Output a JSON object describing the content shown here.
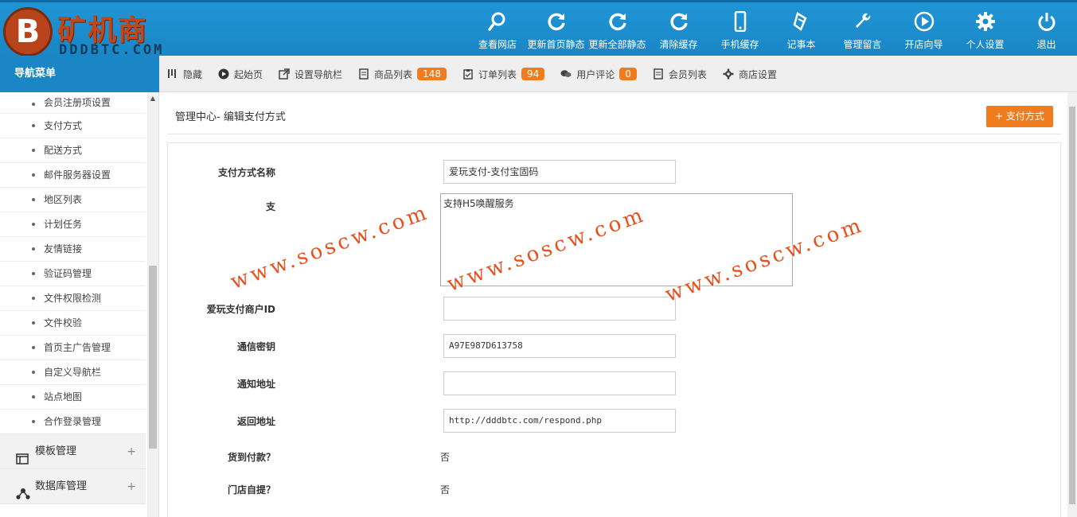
{
  "logo": {
    "badge": "B",
    "title": "矿机商城",
    "subtitle": "DDDBTC.COM"
  },
  "top_nav": [
    {
      "label": "查看网店",
      "icon": "search-icon"
    },
    {
      "label": "更新首页静态",
      "icon": "refresh-icon"
    },
    {
      "label": "更新全部静态",
      "icon": "refresh-icon"
    },
    {
      "label": "清除缓存",
      "icon": "refresh-icon"
    },
    {
      "label": "手机缓存",
      "icon": "mobile-icon"
    },
    {
      "label": "记事本",
      "icon": "notepad-icon"
    },
    {
      "label": "管理留言",
      "icon": "wrench-icon"
    },
    {
      "label": "开店向导",
      "icon": "play-icon"
    },
    {
      "label": "个人设置",
      "icon": "gear-icon"
    },
    {
      "label": "退出",
      "icon": "power-icon"
    }
  ],
  "sidebar": {
    "header": "导航菜单",
    "items": [
      "会员注册项设置",
      "支付方式",
      "配送方式",
      "邮件服务器设置",
      "地区列表",
      "计划任务",
      "友情链接",
      "验证码管理",
      "文件权限检测",
      "文件校验",
      "首页主广告管理",
      "自定义导航栏",
      "站点地图",
      "合作登录管理"
    ],
    "groups": [
      {
        "label": "模板管理",
        "icon": "template-icon",
        "toggle": "+"
      },
      {
        "label": "数据库管理",
        "icon": "database-icon",
        "toggle": "+"
      }
    ]
  },
  "quick_bar": [
    {
      "label": "隐藏",
      "icon": "bars-icon"
    },
    {
      "label": "起始页",
      "icon": "play-circle-icon"
    },
    {
      "label": "设置导航栏",
      "icon": "external-link-icon"
    },
    {
      "label": "商品列表",
      "icon": "list-icon",
      "badge": "148"
    },
    {
      "label": "订单列表",
      "icon": "clipboard-icon",
      "badge": "94"
    },
    {
      "label": "用户评论",
      "icon": "chat-icon",
      "badge": "0"
    },
    {
      "label": "会员列表",
      "icon": "member-icon"
    },
    {
      "label": "商店设置",
      "icon": "shop-icon"
    }
  ],
  "content": {
    "breadcrumb": "管理中心- 编辑支付方式",
    "add_button": "+ 支付方式",
    "form": {
      "name_label": "支付方式名称",
      "name_value": "爱玩支付-支付宝固码",
      "desc_label": "支",
      "desc_value": "支持H5唤醒服务",
      "merchant_label": "爱玩支付商户ID",
      "merchant_value": "",
      "key_label": "通信密钥",
      "key_value": "A97E987D613758",
      "notify_label": "通知地址",
      "notify_value": "",
      "return_label": "返回地址",
      "return_value": "http://dddbtc.com/respond.php",
      "cod_label": "货到付款？",
      "cod_value": "否",
      "pickup_label": "门店自提？",
      "pickup_value": "否"
    }
  },
  "watermark": "www.soscw.com"
}
